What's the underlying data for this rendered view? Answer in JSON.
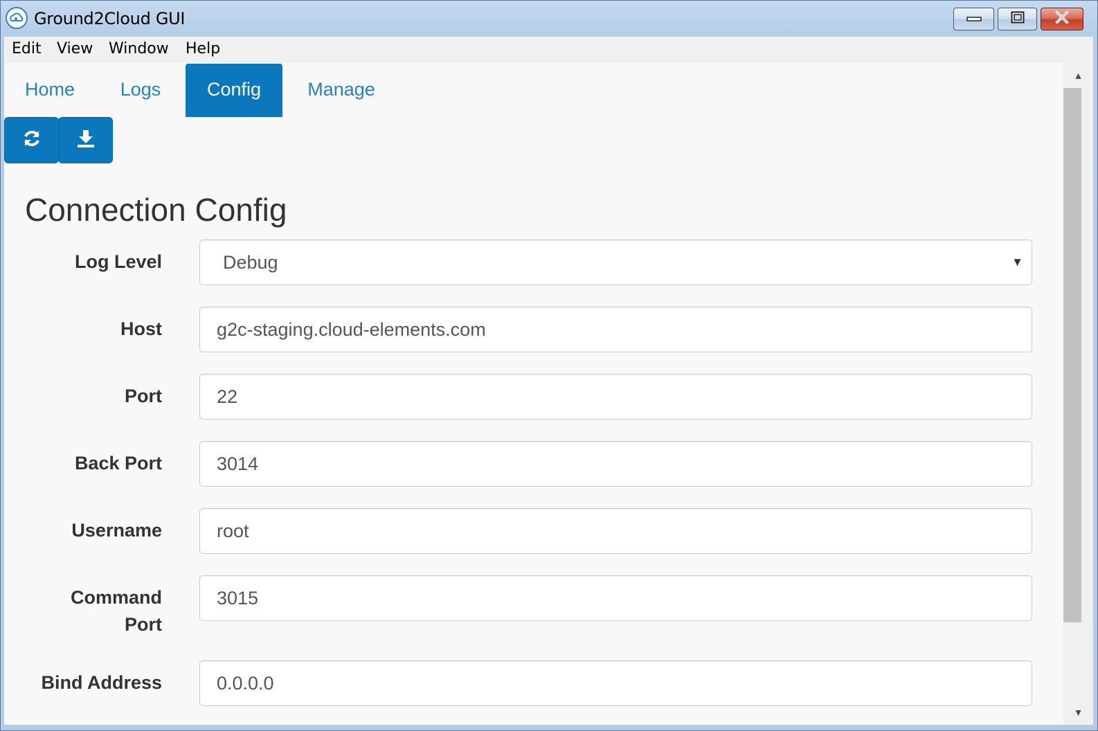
{
  "window": {
    "title": "Ground2Cloud GUI",
    "controls": [
      "minimize",
      "maximize",
      "close"
    ]
  },
  "menu": {
    "items": [
      "Edit",
      "View",
      "Window",
      "Help"
    ]
  },
  "nav": {
    "tabs": [
      {
        "label": "Home",
        "active": false
      },
      {
        "label": "Logs",
        "active": false
      },
      {
        "label": "Config",
        "active": true
      },
      {
        "label": "Manage",
        "active": false
      }
    ]
  },
  "toolbar": {
    "buttons": [
      {
        "icon": "refresh-icon"
      },
      {
        "icon": "download-icon"
      }
    ]
  },
  "section": {
    "title": "Connection Config"
  },
  "form": {
    "log_level": {
      "label": "Log Level",
      "value": "Debug"
    },
    "host": {
      "label": "Host",
      "value": "g2c-staging.cloud-elements.com"
    },
    "port": {
      "label": "Port",
      "value": "22"
    },
    "back_port": {
      "label": "Back Port",
      "value": "3014"
    },
    "username": {
      "label": "Username",
      "value": "root"
    },
    "command_port": {
      "label_line1": "Command",
      "label_line2": "Port",
      "value": "3015"
    },
    "bind_address": {
      "label": "Bind Address",
      "value": "0.0.0.0"
    }
  },
  "colors": {
    "primary": "#0b78be",
    "link": "#2a7fc4",
    "label_text": "#333333",
    "input_text": "#555555"
  }
}
